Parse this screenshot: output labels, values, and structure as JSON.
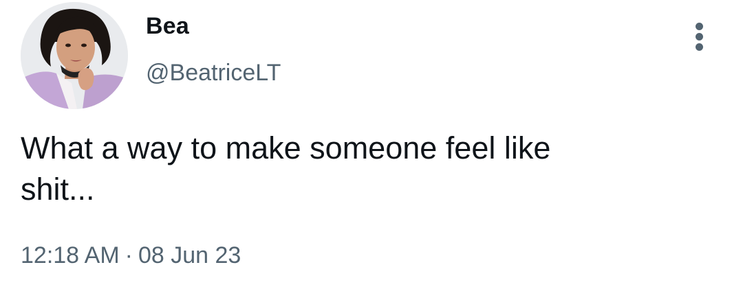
{
  "tweet": {
    "author": {
      "display_name": "Bea",
      "handle": "@BeatriceLT",
      "avatar_icon": "profile-photo"
    },
    "menu_icon": "more-vertical-icon",
    "text": "What a way to make someone feel like\nshit...",
    "time": "12:18 AM",
    "separator": "·",
    "date": "08 Jun 23"
  },
  "colors": {
    "text_primary": "#0f1419",
    "text_secondary": "#536471",
    "background": "#ffffff"
  }
}
